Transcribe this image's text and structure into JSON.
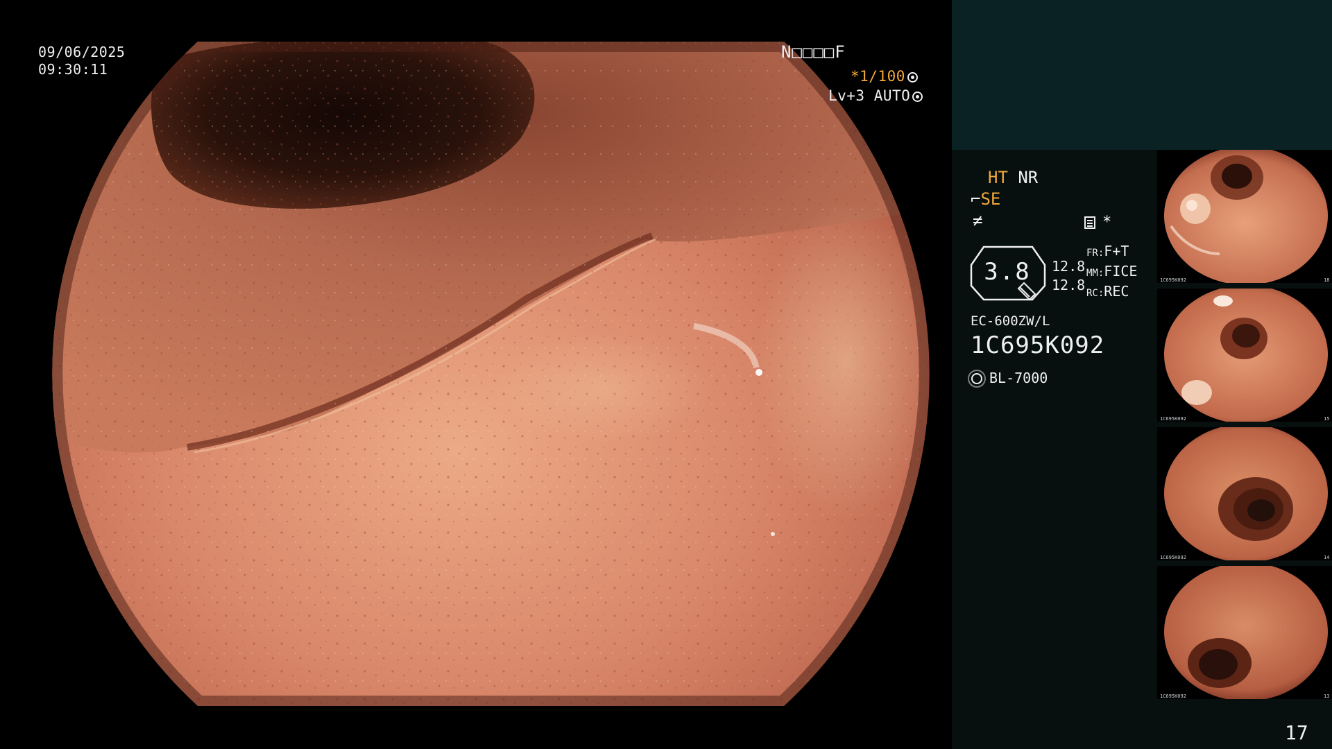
{
  "main": {
    "date": "09/06/2025",
    "time": "09:30:11",
    "patient_id": "N□□□□F",
    "shutter_prefix": "*1/100",
    "level": "Lv+3 AUTO"
  },
  "panel": {
    "ht_label": "HT",
    "nr_label": "NR",
    "se_label": "SE",
    "f_symbol": "≠",
    "star_symbol": "*",
    "zoom": "3.8",
    "zoom_values": [
      "12.8",
      "12.8"
    ],
    "params": [
      {
        "key": "FR:",
        "value": "F+T"
      },
      {
        "key": "MM:",
        "value": "FICE"
      },
      {
        "key": "RC:",
        "value": "REC"
      }
    ],
    "scope_model": "EC-600ZW/L",
    "serial": "1C695K092",
    "light_source": "BL-7000",
    "page_number": "17"
  },
  "thumbnails": [
    {
      "serial": "1C695K092",
      "index": "18"
    },
    {
      "serial": "1C695K092",
      "index": "15"
    },
    {
      "serial": "1C695K092",
      "index": "14"
    },
    {
      "serial": "1C695K092",
      "index": "13"
    }
  ]
}
